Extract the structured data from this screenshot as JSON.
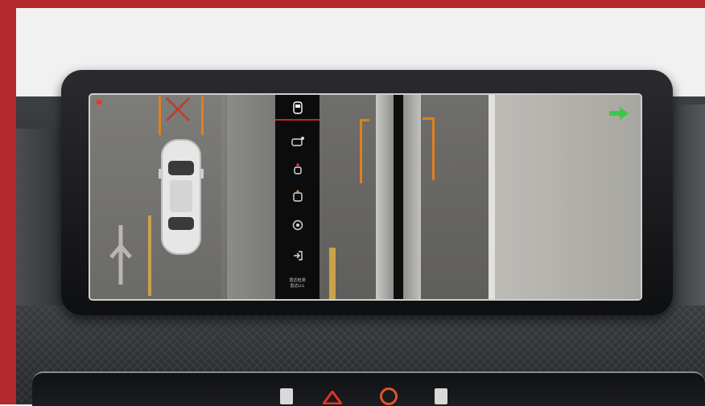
{
  "colors": {
    "frame": "#b2282c",
    "guide": "#e0801f",
    "menu_active": "#c3252b",
    "nav_arrow": "#3cc84b",
    "hazard": "#e0342a"
  },
  "menu": {
    "items": [
      {
        "icon": "car-front-view-icon",
        "active": true
      },
      {
        "icon": "car-side-view-icon",
        "active": false
      },
      {
        "icon": "car-rear-view-icon",
        "active": false
      },
      {
        "icon": "car-top-view-icon",
        "active": false
      },
      {
        "icon": "settings-icon",
        "active": false
      },
      {
        "icon": "exit-icon",
        "active": false
      }
    ],
    "label_line1": "雷达检测",
    "label_line2": "雷达LLL"
  },
  "indicators": {
    "record": "record-indicator-icon",
    "direction": "right-arrow-icon"
  }
}
